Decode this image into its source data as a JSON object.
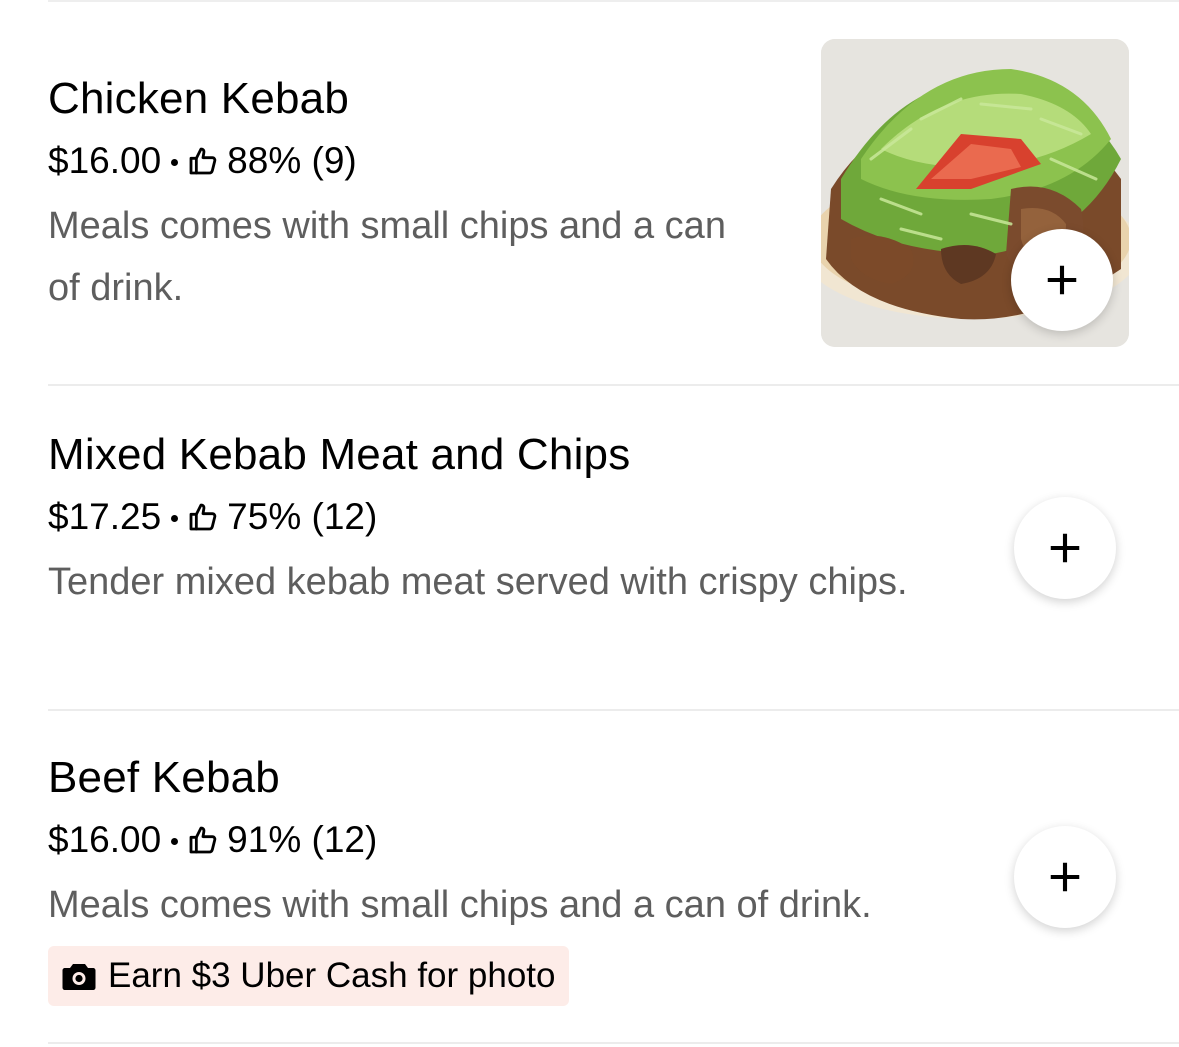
{
  "menu": {
    "items": [
      {
        "title": "Chicken Kebab",
        "price": "$16.00",
        "rating": "88% (9)",
        "description": "Meals comes with small chips and a can of drink.",
        "has_photo": true
      },
      {
        "title": "Mixed Kebab Meat and Chips",
        "price": "$17.25",
        "rating": "75% (12)",
        "description": "Tender mixed kebab meat served with crispy chips.",
        "has_photo": false
      },
      {
        "title": "Beef Kebab",
        "price": "$16.00",
        "rating": "91% (12)",
        "description": "Meals comes with small chips and a can of drink.",
        "has_photo": false,
        "promo": "Earn $3 Uber Cash for photo"
      }
    ]
  },
  "icons": {
    "thumbs_up": "thumbs-up-icon",
    "add": "plus-icon",
    "camera": "camera-icon"
  },
  "colors": {
    "text_primary": "#000000",
    "text_secondary": "#5e5e5e",
    "promo_background": "#fdece8",
    "divider": "#ececec"
  }
}
